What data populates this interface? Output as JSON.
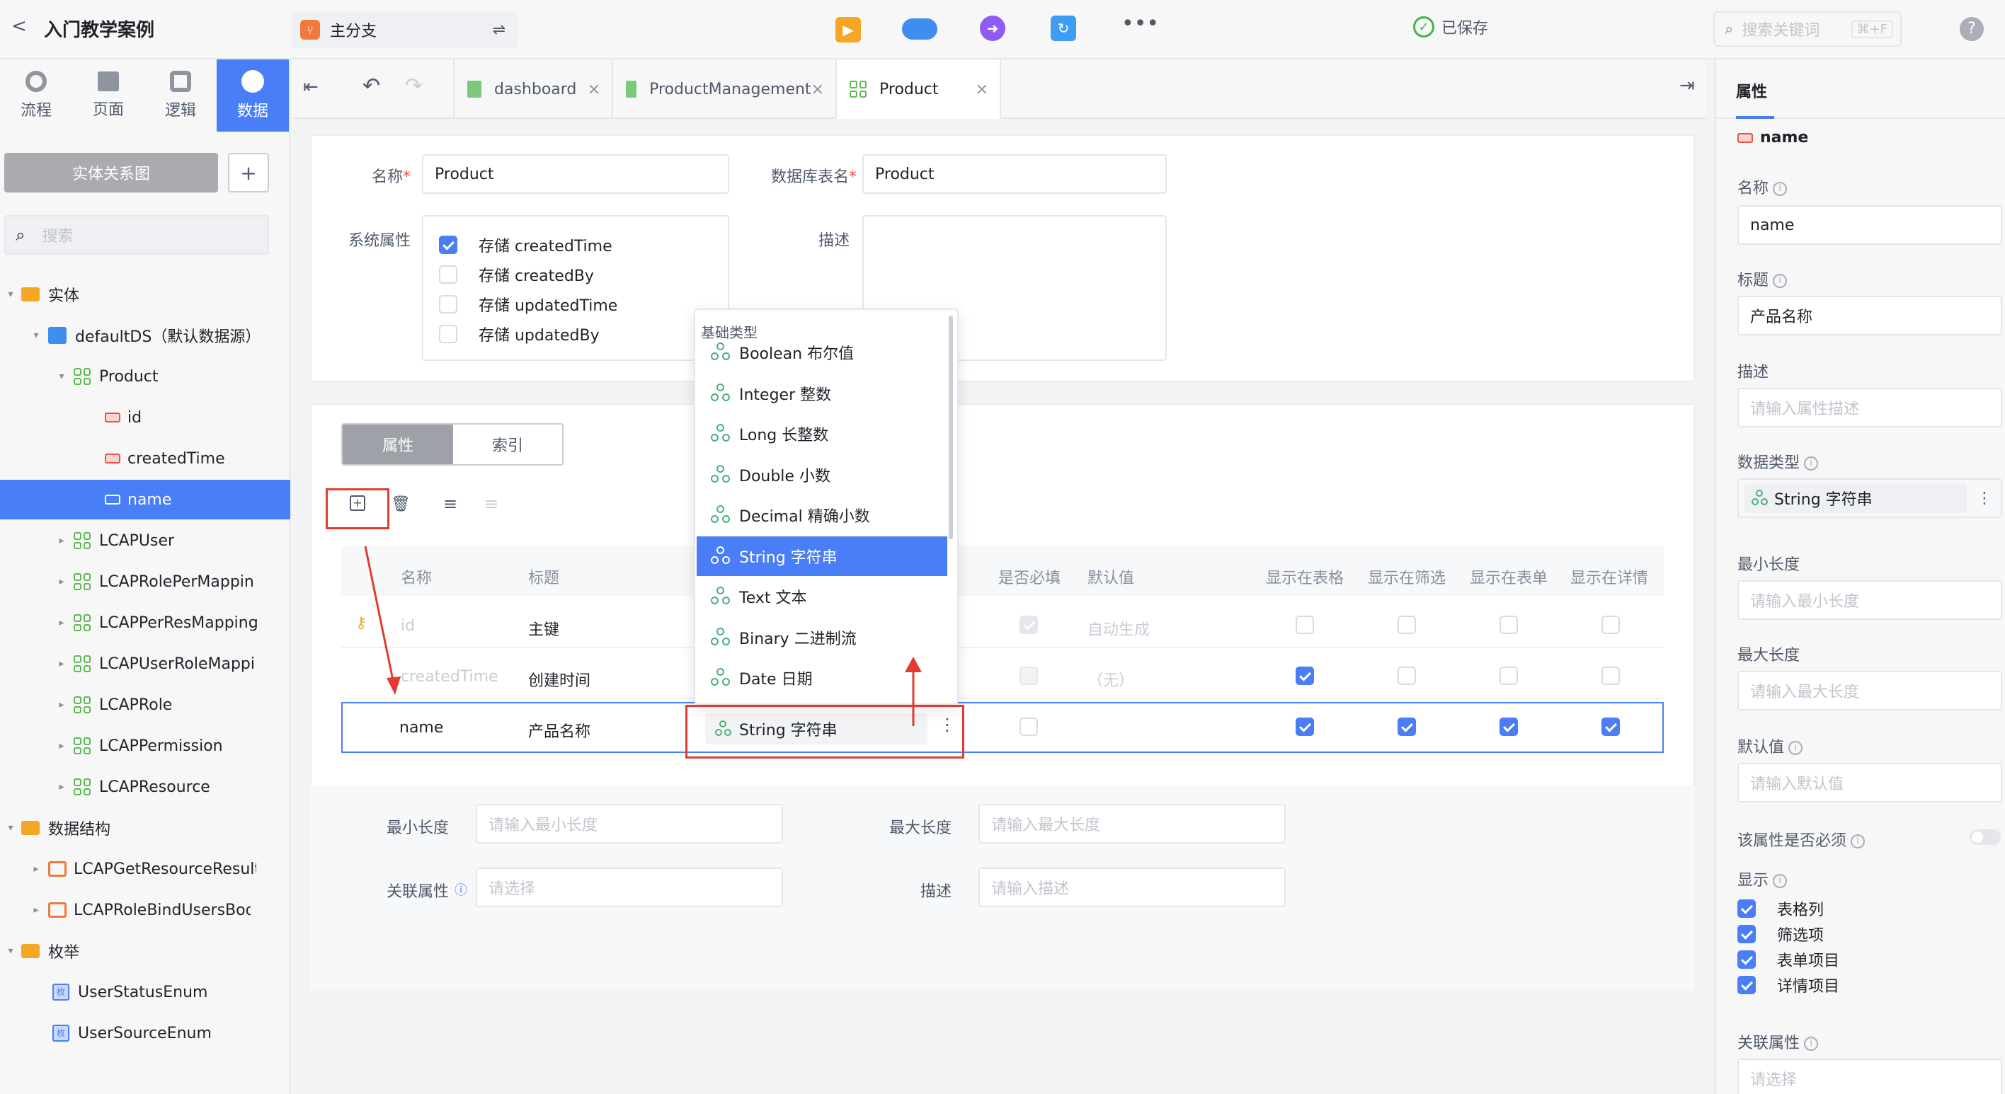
{
  "topbar": {
    "back": "<",
    "project": "入门教学案例",
    "branch": "主分支",
    "saved": "已保存",
    "search_placeholder": "搜索关键词",
    "search_shortcut": "⌘+F",
    "help": "?"
  },
  "leftnav": {
    "tabs": [
      {
        "label": "流程"
      },
      {
        "label": "页面"
      },
      {
        "label": "逻辑"
      },
      {
        "label": "数据"
      }
    ],
    "er_button": "实体关系图",
    "add_button": "+",
    "search_placeholder": "搜索"
  },
  "tree": {
    "entities": "实体",
    "ds": "defaultDS（默认数据源）",
    "product": "Product",
    "id": "id",
    "createdTime": "createdTime",
    "name": "name",
    "lcapuser": "LCAPUser",
    "lcaprolepermapping": "LCAPRolePerMappin",
    "lcapperresmapping": "LCAPPerResMapping",
    "lcapuserrolemapping": "LCAPUserRoleMappi",
    "lcaprole": "LCAPRole",
    "lcappermission": "LCAPPermission",
    "lcapresource": "LCAPResource",
    "structs": "数据结构",
    "getresourceresult": "LCAPGetResourceResult",
    "rolebindusersbody": "LCAPRoleBindUsersBody",
    "enums": "枚举",
    "userstatusenum": "UserStatusEnum",
    "usersourceenum": "UserSourceEnum",
    "enum_badge": "枚"
  },
  "doctabs": [
    {
      "label": "dashboard"
    },
    {
      "label": "ProductManagement"
    },
    {
      "label": "Product"
    }
  ],
  "entity_form": {
    "name_label": "名称",
    "name_value": "Product",
    "table_label": "数据库表名",
    "table_value": "Product",
    "sys_label": "系统属性",
    "desc_label": "描述",
    "sys_options": [
      "存储 createdTime",
      "存储 createdBy",
      "存储 updatedTime",
      "存储 updatedBy"
    ]
  },
  "subtabs": {
    "props": "属性",
    "index": "索引"
  },
  "table": {
    "headers": {
      "name": "名称",
      "title": "标题",
      "required": "是否必填",
      "default": "默认值",
      "show_table": "显示在表格",
      "show_filter": "显示在筛选",
      "show_form": "显示在表单",
      "show_detail": "显示在详情"
    },
    "rows": [
      {
        "name": "id",
        "title": "主键",
        "default": "自动生成"
      },
      {
        "name": "createdTime",
        "title": "创建时间",
        "default": "（无）"
      },
      {
        "name": "name",
        "title": "产品名称",
        "type": "String 字符串"
      }
    ]
  },
  "detail_form": {
    "min_label": "最小长度",
    "min_ph": "请输入最小长度",
    "max_label": "最大长度",
    "max_ph": "请输入最大长度",
    "rel_label": "关联属性",
    "rel_ph": "请选择",
    "desc_label": "描述",
    "desc_ph": "请输入描述"
  },
  "dropdown": {
    "group": "基础类型",
    "items": [
      "Boolean 布尔值",
      "Integer 整数",
      "Long 长整数",
      "Double 小数",
      "Decimal 精确小数",
      "String 字符串",
      "Text 文本",
      "Binary 二进制流",
      "Date 日期"
    ],
    "selected": "String 字符串"
  },
  "panel": {
    "title": "属性",
    "prop": "name",
    "name_label": "名称",
    "name_value": "name",
    "title_label": "标题",
    "title_value": "产品名称",
    "desc_label": "描述",
    "desc_ph": "请输入属性描述",
    "type_label": "数据类型",
    "type_value": "String 字符串",
    "min_label": "最小长度",
    "min_ph": "请输入最小长度",
    "max_label": "最大长度",
    "max_ph": "请输入最大长度",
    "default_label": "默认值",
    "default_ph": "请输入默认值",
    "required_label": "该属性是否必须",
    "display_label": "显示",
    "display_options": [
      "表格列",
      "筛选项",
      "表单项目",
      "详情项目"
    ],
    "rel_label": "关联属性",
    "rel_ph": "请选择"
  },
  "colors": {
    "accent": "#4a7ef7",
    "annotation": "#e13c2f",
    "entity": "#5fb954",
    "property": "#e5534b"
  }
}
